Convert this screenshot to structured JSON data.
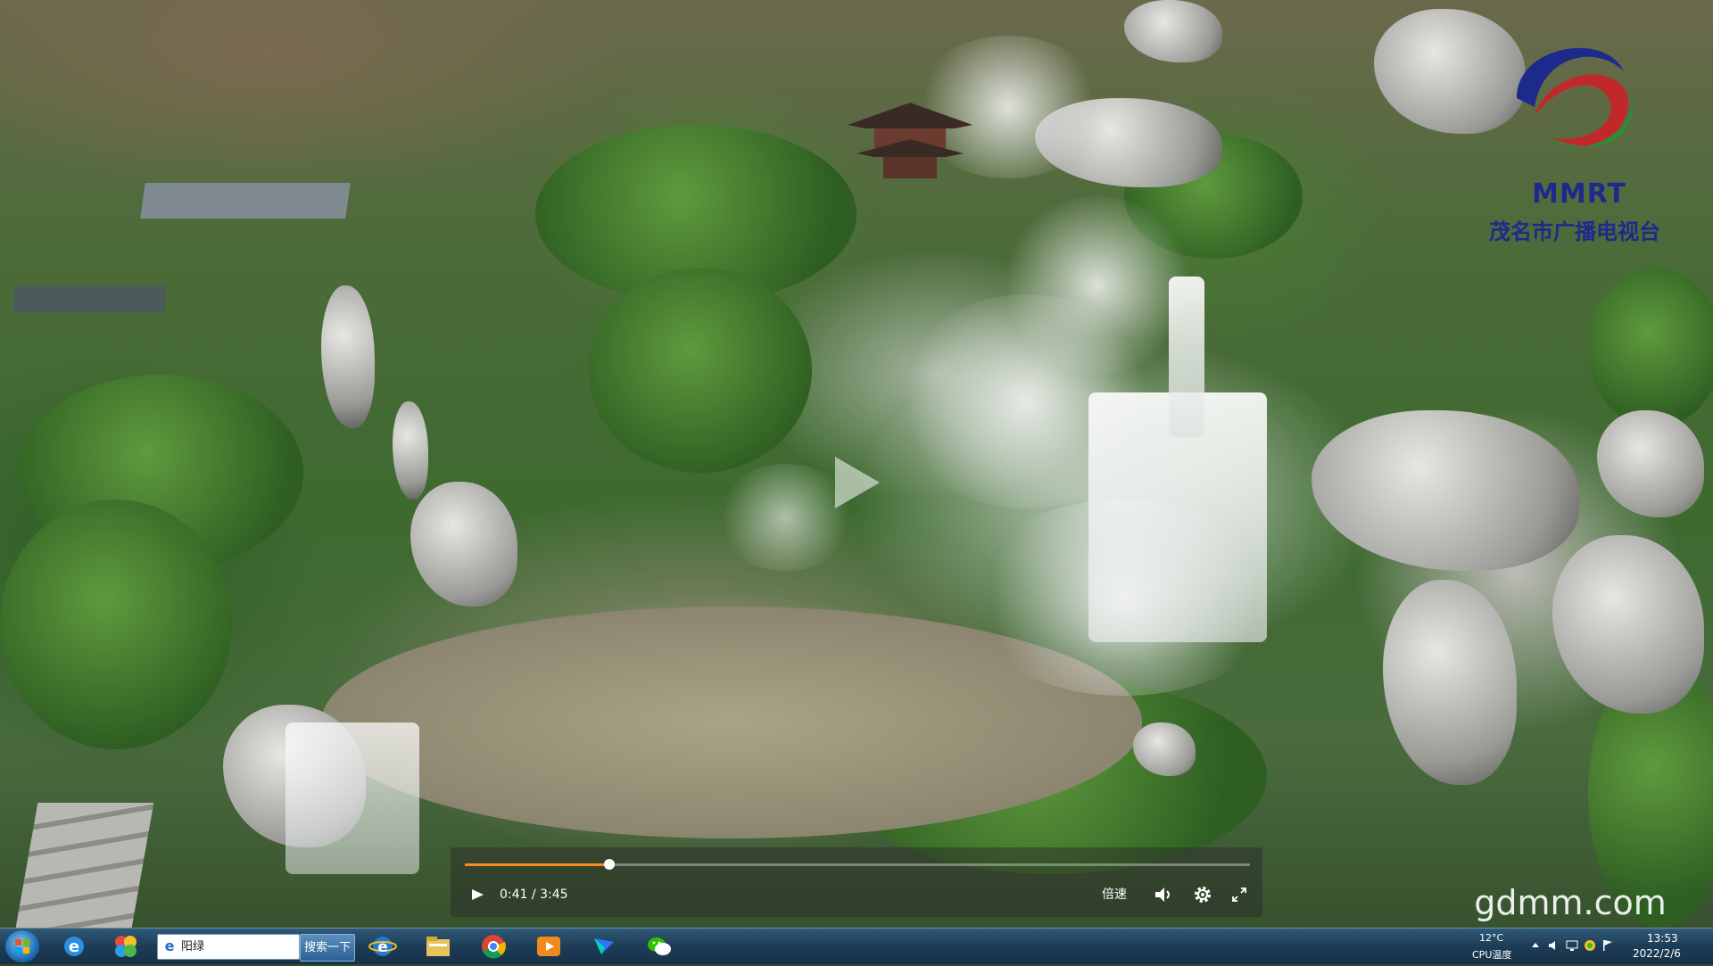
{
  "video": {
    "logo_brand": "MMRT",
    "logo_subtitle": "茂名市广播电视台",
    "watermark": "gdmm.com",
    "progress": 0.184,
    "current_time": "0:41",
    "time_separator": " / ",
    "duration": "3:45",
    "speed_label": "倍速",
    "progress_color": "#ff8c1a"
  },
  "taskbar": {
    "address_text": "阳绿",
    "search_label": "搜索一下",
    "pinned_icons": [
      "ie-icon",
      "colorful-app-icon",
      "ie-browser-icon",
      "file-explorer-icon",
      "chrome-icon",
      "video-player-icon",
      "feishu-icon",
      "wechat-icon"
    ],
    "weather_temp": "12°C",
    "cpu_label": "CPU温度",
    "clock_time": "13:53",
    "clock_date": "2022/2/6"
  }
}
